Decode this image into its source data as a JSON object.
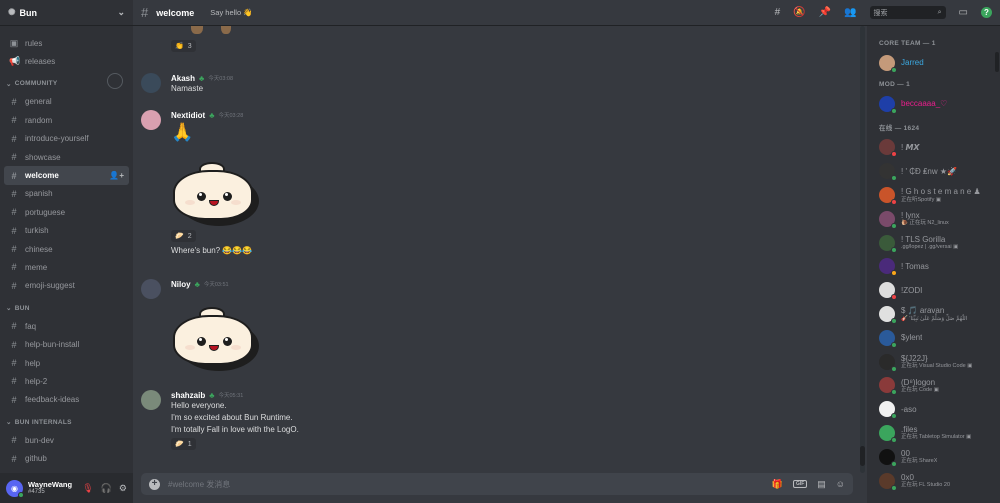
{
  "server": {
    "name": "Bun"
  },
  "channels_top": [
    {
      "name": "rules",
      "icon": "rules-icon",
      "glyph": "▣"
    },
    {
      "name": "releases",
      "icon": "megaphone-icon",
      "glyph": "📢"
    }
  ],
  "categories": [
    {
      "label": "COMMUNITY",
      "channels": [
        {
          "name": "general",
          "glyph": "#"
        },
        {
          "name": "random",
          "glyph": "#"
        },
        {
          "name": "introduce-yourself",
          "glyph": "#"
        },
        {
          "name": "showcase",
          "glyph": "#"
        },
        {
          "name": "welcome",
          "glyph": "#",
          "active": true
        },
        {
          "name": "spanish",
          "glyph": "#"
        },
        {
          "name": "portuguese",
          "glyph": "#"
        },
        {
          "name": "turkish",
          "glyph": "#"
        },
        {
          "name": "chinese",
          "glyph": "#"
        },
        {
          "name": "meme",
          "glyph": "#"
        },
        {
          "name": "emoji-suggest",
          "glyph": "#"
        }
      ]
    },
    {
      "label": "BUN",
      "channels": [
        {
          "name": "faq",
          "glyph": "#"
        },
        {
          "name": "help-bun-install",
          "glyph": "#"
        },
        {
          "name": "help",
          "glyph": "#"
        },
        {
          "name": "help-2",
          "glyph": "#"
        },
        {
          "name": "feedback-ideas",
          "glyph": "#"
        }
      ]
    },
    {
      "label": "BUN INTERNALS",
      "channels": [
        {
          "name": "bun-dev",
          "glyph": "#"
        },
        {
          "name": "github",
          "glyph": "#"
        }
      ]
    }
  ],
  "user": {
    "name": "WayneWang",
    "tag": "#4735"
  },
  "channel": {
    "title": "welcome",
    "topic": "Say hello 👋"
  },
  "search": {
    "placeholder": "搜索"
  },
  "composer": {
    "placeholder": "#welcome 发消息"
  },
  "messages": [
    {
      "reaction_top": {
        "emoji": "👏",
        "count": "3"
      }
    },
    {
      "author": "Akash",
      "time": "今天03:08",
      "lines": [
        "Namaste"
      ]
    },
    {
      "author": "Nextidiot",
      "time": "今天03:28",
      "emoji_line": "🙏",
      "reaction": {
        "emoji": "🥟",
        "count": "2"
      },
      "after": "Where's bun? 😂😂😂"
    },
    {
      "author": "Niloy",
      "time": "今天03:51"
    },
    {
      "author": "shahzaib",
      "time": "今天05:31",
      "lines": [
        "Hello everyone.",
        "I'm so excited about Bun Runtime.",
        "I'm totally Fall in love with the LogO."
      ],
      "reaction": {
        "emoji": "🥟",
        "count": "1"
      }
    }
  ],
  "member_groups": [
    {
      "label": "CORE TEAM — 1",
      "members": [
        {
          "name": "Jarred",
          "color": "#3ba8e0",
          "av": "#c49a7a",
          "status": "#3ba55d"
        }
      ]
    },
    {
      "label": "MOD — 1",
      "members": [
        {
          "name": "beccaaaa_♡",
          "color": "#e91e8c",
          "av": "#1e3fa8",
          "status": "#3ba55d"
        }
      ]
    },
    {
      "label": "在线 — 1624",
      "members": [
        {
          "name": "! 𝙈𝙓",
          "color": "#96989d",
          "av": "#6a3a3a",
          "status": "#ed4245"
        },
        {
          "name": "! ' ₵Ð ₤nw ★🚀",
          "color": "#96989d",
          "av": "#333",
          "status": "#3ba55d"
        },
        {
          "name": "! G h o s t e m a n e ♟",
          "color": "#96989d",
          "av": "#c9542a",
          "status": "#ed4245",
          "activity": "正在听Spotify ▣"
        },
        {
          "name": "! lynx",
          "color": "#96989d",
          "av": "#7a4a6a",
          "status": "#3ba55d",
          "activity": "🐌 正在玩 N2_linux"
        },
        {
          "name": "! TLS Gorilla",
          "color": "#96989d",
          "av": "#3a5a3a",
          "status": "#3ba55d",
          "activity": ".gg/lopez | .gg/versai ▣"
        },
        {
          "name": "! Tomas",
          "color": "#96989d",
          "av": "#4a2a7a",
          "status": "#faa61a"
        },
        {
          "name": "!ZODI",
          "color": "#96989d",
          "av": "#ddd",
          "status": "#ed4245"
        },
        {
          "name": "$ 🎵 aravan",
          "color": "#96989d",
          "av": "#e0e0e0",
          "status": "#3ba55d",
          "activity": "🎸 'اللّهُمَّ صَلِّ وَسَلِّمْ عَلَىٰ نَبِيِّنَا"
        },
        {
          "name": "$ylent",
          "color": "#96989d",
          "av": "#2a5a9a",
          "status": "#3ba55d"
        },
        {
          "name": "${J22J}",
          "color": "#96989d",
          "av": "#2a2a2a",
          "status": "#3ba55d",
          "activity": "正在玩 Visual Studio Code ▣"
        },
        {
          "name": "(D⁸)logon",
          "color": "#96989d",
          "av": "#8a3a3a",
          "status": "#3ba55d",
          "activity": "正在玩 Code ▣"
        },
        {
          "name": "-aso",
          "color": "#96989d",
          "av": "#f0f0f0",
          "status": "#3ba55d"
        },
        {
          "name": ".files",
          "color": "#96989d",
          "av": "#3ba55d",
          "status": "#3ba55d",
          "activity": "正在玩 Tabletop Simulator ▣"
        },
        {
          "name": "00",
          "color": "#96989d",
          "av": "#111",
          "status": "#3ba55d",
          "activity": "正在玩 ShareX"
        },
        {
          "name": "0x0",
          "color": "#96989d",
          "av": "#5a3a2a",
          "status": "#3ba55d",
          "activity": "正在玩 FL Studio 20"
        }
      ]
    }
  ]
}
